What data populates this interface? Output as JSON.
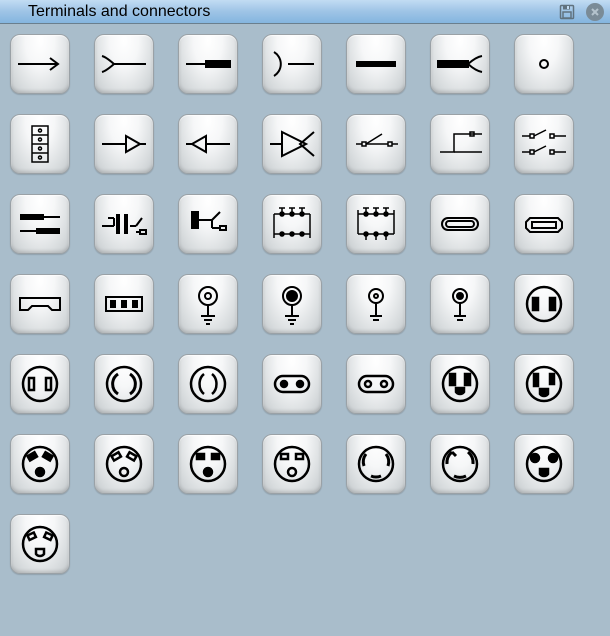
{
  "window": {
    "title": "Terminals and connectors"
  },
  "toolbar": {
    "save_icon": "save-icon",
    "close_icon": "close-icon"
  },
  "items": [
    {
      "name": "arrow-wire",
      "row": 1,
      "col": 1
    },
    {
      "name": "open-wire-terminal",
      "row": 1,
      "col": 2
    },
    {
      "name": "male-terminal",
      "row": 1,
      "col": 3
    },
    {
      "name": "female-terminal",
      "row": 1,
      "col": 4
    },
    {
      "name": "thick-terminal",
      "row": 1,
      "col": 5
    },
    {
      "name": "thick-open-terminal",
      "row": 1,
      "col": 6
    },
    {
      "name": "circular-node",
      "row": 1,
      "col": 7
    },
    {
      "name": "terminal-block-4",
      "row": 2,
      "col": 1
    },
    {
      "name": "arrow-wire-hollow-right",
      "row": 2,
      "col": 2
    },
    {
      "name": "arrow-wire-hollow-left",
      "row": 2,
      "col": 3
    },
    {
      "name": "double-arrow-hollow",
      "row": 2,
      "col": 4
    },
    {
      "name": "switch-single-node",
      "row": 2,
      "col": 5
    },
    {
      "name": "switch-step",
      "row": 2,
      "col": 6
    },
    {
      "name": "switch-double",
      "row": 2,
      "col": 7
    },
    {
      "name": "double-terminal-bars",
      "row": 3,
      "col": 1
    },
    {
      "name": "capacitor-terminal",
      "row": 3,
      "col": 2
    },
    {
      "name": "terminal-post",
      "row": 3,
      "col": 3
    },
    {
      "name": "bus-connector-4a",
      "row": 3,
      "col": 4
    },
    {
      "name": "bus-connector-4b",
      "row": 3,
      "col": 5
    },
    {
      "name": "usb-port-a",
      "row": 3,
      "col": 6
    },
    {
      "name": "usb-port-b",
      "row": 3,
      "col": 7
    },
    {
      "name": "port-slot-wide",
      "row": 4,
      "col": 1
    },
    {
      "name": "port-slot-triple",
      "row": 4,
      "col": 2
    },
    {
      "name": "jack-pin-open",
      "row": 4,
      "col": 3
    },
    {
      "name": "jack-pin-filled",
      "row": 4,
      "col": 4
    },
    {
      "name": "jack-pin-small-open",
      "row": 4,
      "col": 5
    },
    {
      "name": "jack-pin-small-filled",
      "row": 4,
      "col": 6
    },
    {
      "name": "outlet-2pin-filled",
      "row": 4,
      "col": 7
    },
    {
      "name": "outlet-2pin-outline",
      "row": 5,
      "col": 1
    },
    {
      "name": "outlet-round-arcs",
      "row": 5,
      "col": 2
    },
    {
      "name": "outlet-round-arcs-alt",
      "row": 5,
      "col": 3
    },
    {
      "name": "outlet-2dot",
      "row": 5,
      "col": 4
    },
    {
      "name": "outlet-2dot-hollow",
      "row": 5,
      "col": 5
    },
    {
      "name": "outlet-2blade-ground",
      "row": 5,
      "col": 6
    },
    {
      "name": "outlet-2blade-ground-us",
      "row": 5,
      "col": 7
    },
    {
      "name": "outlet-3ph-a",
      "row": 6,
      "col": 1
    },
    {
      "name": "outlet-3ph-b",
      "row": 6,
      "col": 2
    },
    {
      "name": "outlet-3ph-c",
      "row": 6,
      "col": 3
    },
    {
      "name": "outlet-3ph-d",
      "row": 6,
      "col": 4
    },
    {
      "name": "outlet-locking-a",
      "row": 6,
      "col": 5
    },
    {
      "name": "outlet-locking-b",
      "row": 6,
      "col": 6
    },
    {
      "name": "outlet-locking-c",
      "row": 6,
      "col": 7
    },
    {
      "name": "outlet-locking-d",
      "row": 7,
      "col": 1
    }
  ]
}
